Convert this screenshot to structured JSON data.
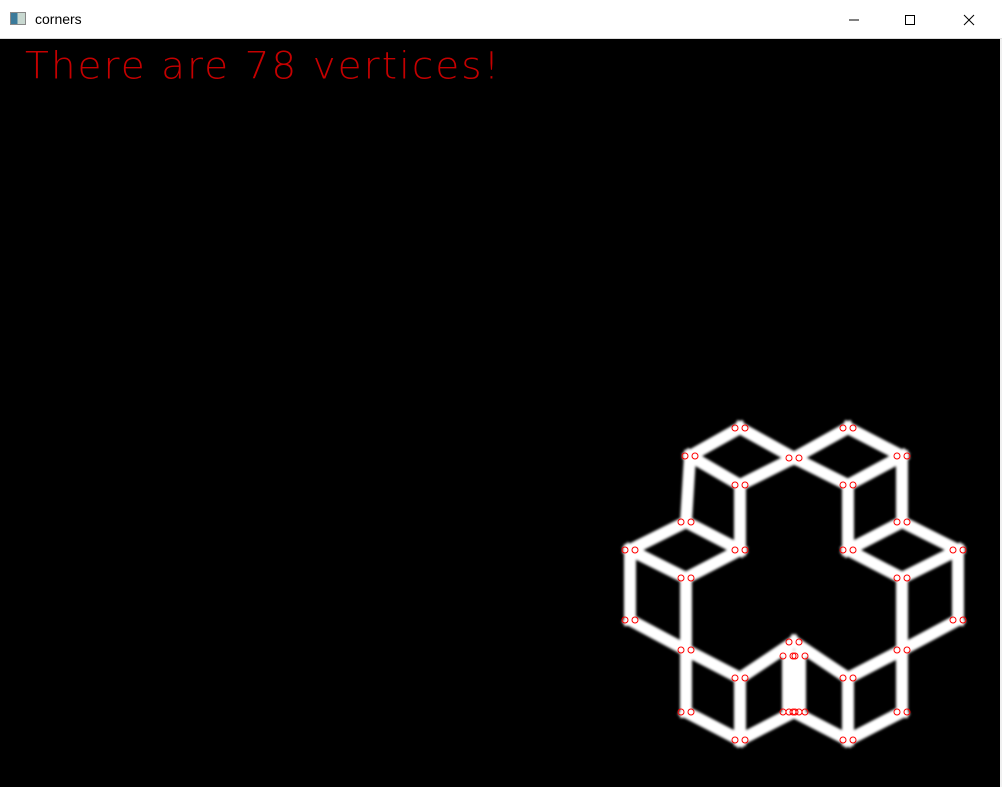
{
  "window": {
    "title": "corners",
    "minimize_icon": "minimize-icon",
    "maximize_icon": "maximize-icon",
    "close_icon": "close-icon"
  },
  "canvas": {
    "message": "There are 78 vertices!",
    "vertex_count": 78,
    "text_color": "#d00000",
    "shape_color": "#ffffff",
    "marker_color": "#ff0000"
  }
}
